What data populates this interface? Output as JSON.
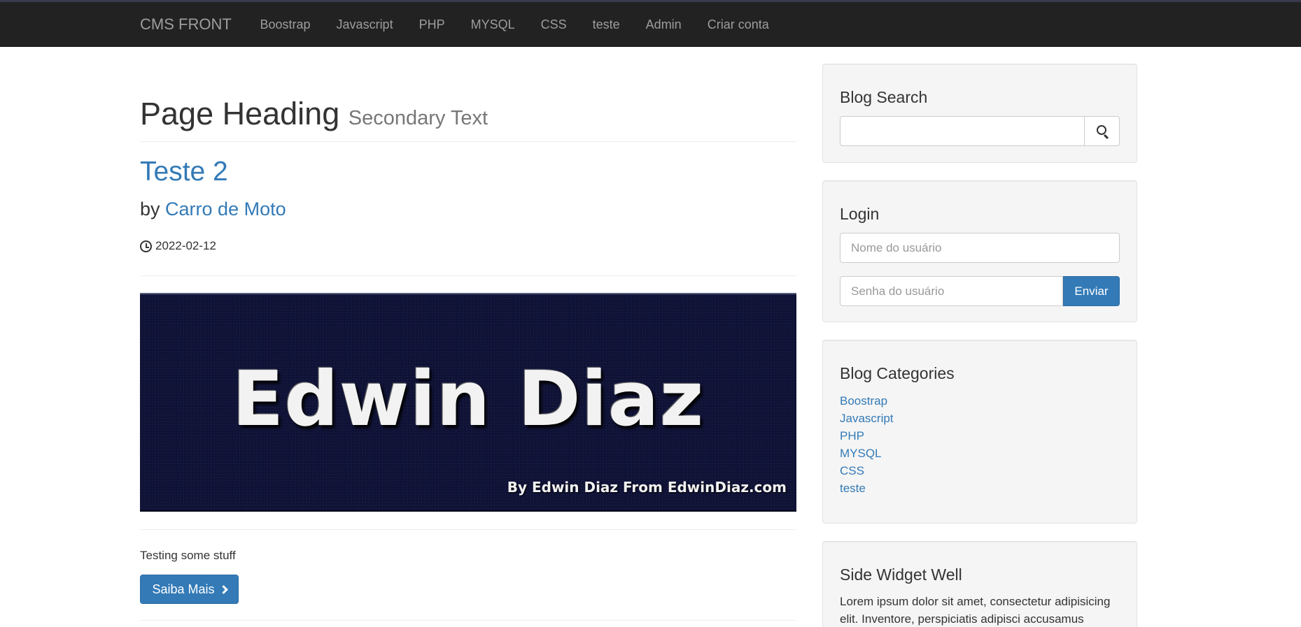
{
  "navbar": {
    "brand": "CMS FRONT",
    "links": [
      "Boostrap",
      "Javascript",
      "PHP",
      "MYSQL",
      "CSS",
      "teste",
      "Admin",
      "Criar conta"
    ]
  },
  "main": {
    "heading": "Page Heading",
    "heading_secondary": "Secondary Text",
    "post": {
      "title": "Teste 2",
      "by_label": "by",
      "author": "Carro de Moto",
      "date": "2022-02-12",
      "banner_title": "Edwin Diaz",
      "banner_subtitle": "By Edwin Diaz From EdwinDiaz.com",
      "excerpt": "Testing some stuff",
      "read_more": "Saiba Mais"
    }
  },
  "sidebar": {
    "search": {
      "title": "Blog Search",
      "value": "",
      "placeholder": ""
    },
    "login": {
      "title": "Login",
      "username_placeholder": "Nome do usuário",
      "password_placeholder": "Senha do usuário",
      "submit_label": "Enviar"
    },
    "categories": {
      "title": "Blog Categories",
      "items": [
        "Boostrap",
        "Javascript",
        "PHP",
        "MYSQL",
        "CSS",
        "teste"
      ]
    },
    "widget": {
      "title": "Side Widget Well",
      "text": "Lorem ipsum dolor sit amet, consectetur adipisicing elit. Inventore, perspiciatis adipisci accusamus"
    }
  },
  "colors": {
    "navbar_bg": "#222222",
    "link": "#337ab7",
    "primary_button": "#337ab7",
    "well_bg": "#f5f5f5",
    "banner_bg": "#101338"
  },
  "icons": {
    "date": "clock-icon",
    "search": "search-icon",
    "read_more": "chevron-right-icon"
  }
}
